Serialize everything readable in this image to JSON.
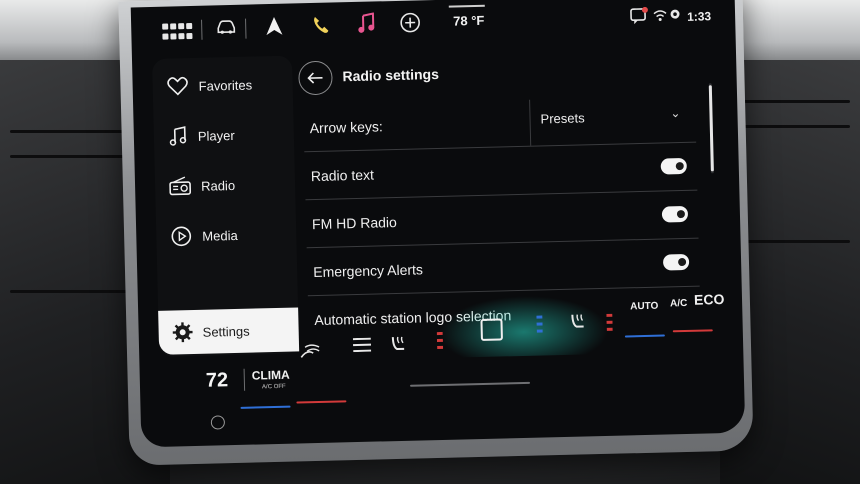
{
  "topbar": {
    "temperature": "78 °F",
    "clock": "1:33",
    "icons": [
      "apps-grid-icon",
      "car-icon",
      "navigation-icon",
      "phone-icon",
      "music-icon",
      "add-icon",
      "message-icon",
      "wifi-icon",
      "settings-gear-icon"
    ]
  },
  "sidebar": {
    "items": [
      {
        "label": "Favorites",
        "icon": "heart-icon"
      },
      {
        "label": "Player",
        "icon": "music-note-icon"
      },
      {
        "label": "Radio",
        "icon": "radio-icon"
      },
      {
        "label": "Media",
        "icon": "play-circle-icon"
      },
      {
        "label": "Settings",
        "icon": "gear-icon",
        "active": true
      }
    ]
  },
  "main": {
    "title": "Radio settings",
    "arrow_keys": {
      "label": "Arrow keys:",
      "value": "Presets"
    },
    "toggles": [
      {
        "label": "Radio text",
        "on": true
      },
      {
        "label": "FM HD Radio",
        "on": true
      },
      {
        "label": "Emergency Alerts",
        "on": true
      },
      {
        "label": "Automatic station logo selection",
        "on": true
      }
    ]
  },
  "climate": {
    "temp_left": "72",
    "clima_label": "CLIMA",
    "clima_sub": "A/C OFF",
    "auto": "AUTO",
    "ac": "A/C",
    "eco": "ECO"
  },
  "colors": {
    "heat": "#d23a3a",
    "cool": "#2f6fd6",
    "accent_glow": "#28d2be",
    "phone": "#f1d25a",
    "music": "#e7558f"
  }
}
